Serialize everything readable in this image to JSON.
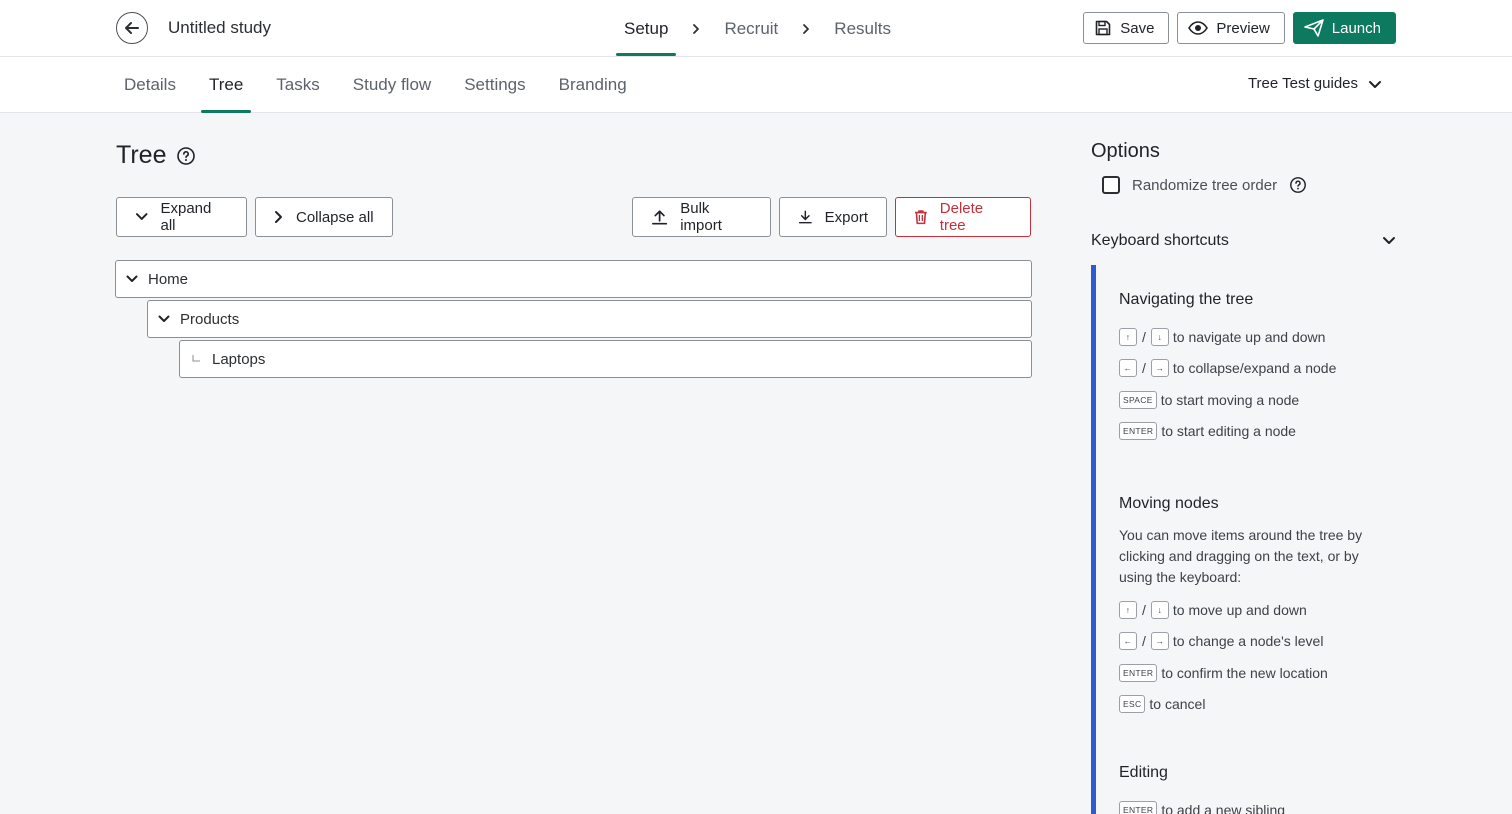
{
  "header": {
    "study_title": "Untitled study",
    "steps": [
      "Setup",
      "Recruit",
      "Results"
    ],
    "active_step": "Setup",
    "save_label": "Save",
    "preview_label": "Preview",
    "launch_label": "Launch",
    "accent_color": "#0d7a5f"
  },
  "subnav": {
    "tabs": [
      "Details",
      "Tree",
      "Tasks",
      "Study flow",
      "Settings",
      "Branding"
    ],
    "active_tab": "Tree",
    "guides_label": "Tree Test guides"
  },
  "main": {
    "title": "Tree",
    "expand_all": "Expand all",
    "collapse_all": "Collapse all",
    "bulk_import": "Bulk import",
    "export": "Export",
    "delete_tree": "Delete tree",
    "danger_color": "#c4303b",
    "tree": [
      {
        "label": "Home",
        "level": 0,
        "expanded": true
      },
      {
        "label": "Products",
        "level": 1,
        "expanded": true
      },
      {
        "label": "Laptops",
        "level": 2,
        "leaf": true
      }
    ]
  },
  "options": {
    "title": "Options",
    "randomize_label": "Randomize tree order",
    "randomize_checked": false,
    "shortcuts_title": "Keyboard shortcuts",
    "panel_color": "#2d5bd1",
    "sections": {
      "navigating": {
        "title": "Navigating the tree",
        "rows": [
          {
            "keys": [
              "↑",
              "↓"
            ],
            "text": "to navigate up and down"
          },
          {
            "keys": [
              "←",
              "→"
            ],
            "text": "to collapse/expand a node"
          },
          {
            "keys": [
              "SPACE"
            ],
            "text": "to start moving a node"
          },
          {
            "keys": [
              "ENTER"
            ],
            "text": "to start editing a node"
          }
        ]
      },
      "moving": {
        "title": "Moving nodes",
        "description": "You can move items around the tree by clicking and dragging on the text, or by using the keyboard:",
        "rows": [
          {
            "keys": [
              "↑",
              "↓"
            ],
            "text": "to move up and down"
          },
          {
            "keys": [
              "←",
              "→"
            ],
            "text": "to change a node's level"
          },
          {
            "keys": [
              "ENTER"
            ],
            "text": "to confirm the new location"
          },
          {
            "keys": [
              "ESC"
            ],
            "text": "to cancel"
          }
        ]
      },
      "editing": {
        "title": "Editing",
        "rows": [
          {
            "keys": [
              "ENTER"
            ],
            "text": "to add a new sibling"
          }
        ]
      }
    }
  }
}
